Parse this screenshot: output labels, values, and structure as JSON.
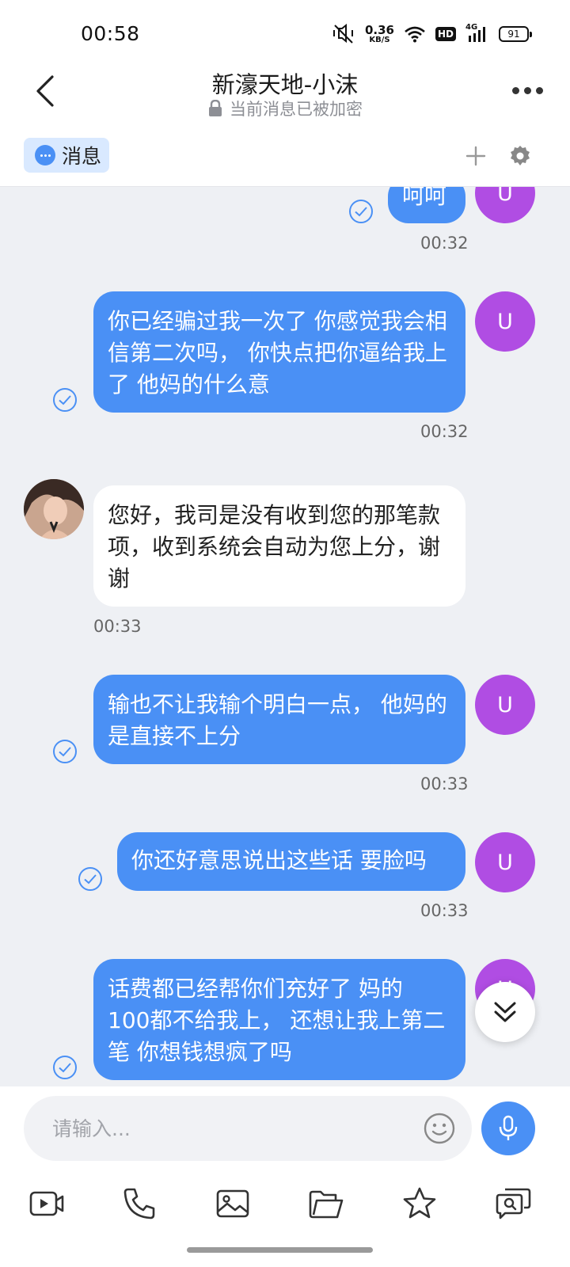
{
  "status_bar": {
    "time": "00:58",
    "net_speed_value": "0.36",
    "net_speed_unit": "KB/S",
    "hd_label": "HD",
    "network_label": "4G",
    "battery": "91"
  },
  "header": {
    "title": "新濠天地-小沫",
    "subtitle": "当前消息已被加密"
  },
  "tabs": [
    {
      "label": "消息",
      "active": true
    }
  ],
  "messages": [
    {
      "direction": "out",
      "text": "呵呵",
      "time": "00:32",
      "avatar_letter": "U",
      "read": true
    },
    {
      "direction": "out",
      "text": "你已经骗过我一次了 你感觉我会相信第二次吗， 你快点把你逼给我上了 他妈的什么意",
      "time": "00:32",
      "avatar_letter": "U",
      "read": true
    },
    {
      "direction": "in",
      "text": "您好，我司是没有收到您的那笔款项，收到系统会自动为您上分，谢谢",
      "time": "00:33"
    },
    {
      "direction": "out",
      "text": "输也不让我输个明白一点， 他妈的 是直接不上分",
      "time": "00:33",
      "avatar_letter": "U",
      "read": true
    },
    {
      "direction": "out",
      "text": "你还好意思说出这些话 要脸吗",
      "time": "00:33",
      "avatar_letter": "U",
      "read": true
    },
    {
      "direction": "out",
      "text": "话费都已经帮你们充好了 妈的 100都不给我上， 还想让我上第二笔 你想钱想疯了吗",
      "time": "",
      "avatar_letter": "U",
      "read": true
    }
  ],
  "input": {
    "placeholder": "请输入...",
    "value": ""
  },
  "icons": {
    "back": "back-arrow-icon",
    "more": "more-dots-icon",
    "lock": "lock-icon",
    "add": "plus-icon",
    "settings": "gear-icon",
    "emoji": "emoji-icon",
    "mic": "microphone-icon",
    "scroll": "double-chevron-down-icon",
    "toolbar": [
      "video-icon",
      "phone-icon",
      "image-icon",
      "folder-icon",
      "star-icon",
      "chat-search-icon"
    ]
  },
  "colors": {
    "accent": "#4a90f5",
    "avatar_purple": "#b04de3",
    "tab_active_bg": "#d9e9ff",
    "chat_bg": "#eef0f4"
  }
}
